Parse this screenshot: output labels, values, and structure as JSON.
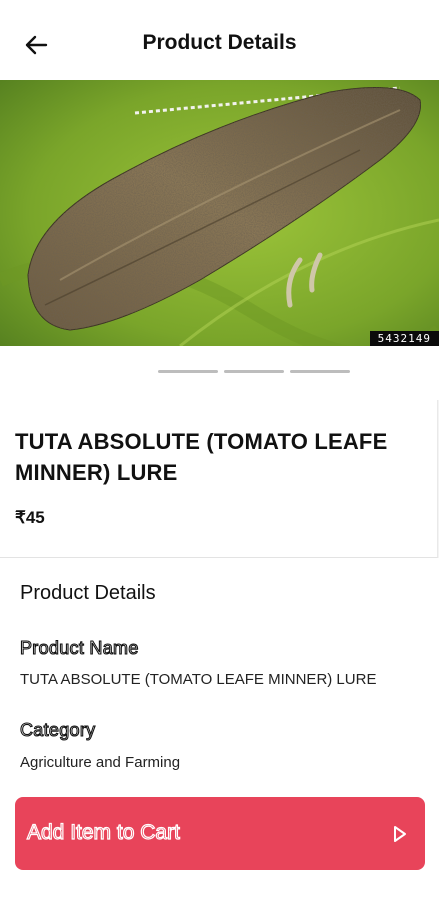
{
  "header": {
    "title": "Product Details",
    "back_icon": "arrow-left-icon"
  },
  "gallery": {
    "image_id": "5432149",
    "slides": 3,
    "active_slide": 1
  },
  "product": {
    "title": "TUTA ABSOLUTE (TOMATO LEAFE MINNER) LURE",
    "price": "₹45"
  },
  "details": {
    "heading": "Product Details",
    "name_label": "Product Name",
    "name_value": "TUTA ABSOLUTE (TOMATO LEAFE MINNER) LURE",
    "category_label": "Category",
    "category_value": "Agriculture and Farming"
  },
  "cart": {
    "label": "Add Item to Cart",
    "icon": "play-arrow-icon",
    "color": "#e8445a"
  }
}
